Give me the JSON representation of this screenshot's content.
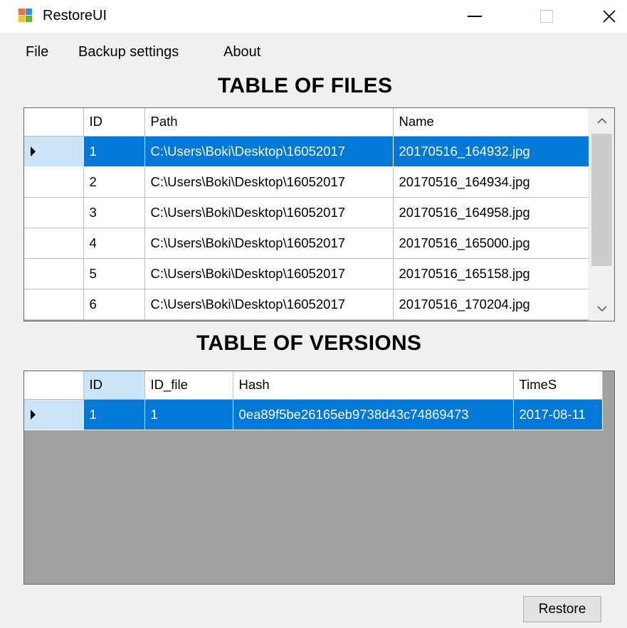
{
  "window": {
    "title": "RestoreUI"
  },
  "menu": [
    "File",
    "Backup settings",
    "About"
  ],
  "files_section": {
    "title": "TABLE OF FILES",
    "columns": [
      "ID",
      "Path",
      "Name"
    ],
    "rows": [
      {
        "id": "1",
        "path": "C:\\Users\\Boki\\Desktop\\16052017",
        "name": "20170516_164932.jpg"
      },
      {
        "id": "2",
        "path": "C:\\Users\\Boki\\Desktop\\16052017",
        "name": "20170516_164934.jpg"
      },
      {
        "id": "3",
        "path": "C:\\Users\\Boki\\Desktop\\16052017",
        "name": "20170516_164958.jpg"
      },
      {
        "id": "4",
        "path": "C:\\Users\\Boki\\Desktop\\16052017",
        "name": "20170516_165000.jpg"
      },
      {
        "id": "5",
        "path": "C:\\Users\\Boki\\Desktop\\16052017",
        "name": "20170516_165158.jpg"
      },
      {
        "id": "6",
        "path": "C:\\Users\\Boki\\Desktop\\16052017",
        "name": "20170516_170204.jpg"
      }
    ],
    "selected_index": 0
  },
  "versions_section": {
    "title": "TABLE OF VERSIONS",
    "columns": [
      "ID",
      "ID_file",
      "Hash",
      "TimeS"
    ],
    "rows": [
      {
        "id": "1",
        "id_file": "1",
        "hash": "0ea89f5be26165eb9738d43c74869473",
        "times": "2017-08-11"
      }
    ],
    "selected_index": 0
  },
  "actions": {
    "restore_label": "Restore"
  },
  "icons": {
    "app": "app-window-icon",
    "minimize": "minimize-icon",
    "maximize": "maximize-icon",
    "close": "close-icon",
    "scroll_up": "chevron-up-icon",
    "scroll_down": "chevron-down-icon",
    "row_selector": "row-pointer-icon"
  },
  "colors": {
    "selection": "#0078d7",
    "row_header_selected": "#cce4f7",
    "grid_background": "#a0a0a0",
    "column_header_selected": "#cce4f7"
  }
}
